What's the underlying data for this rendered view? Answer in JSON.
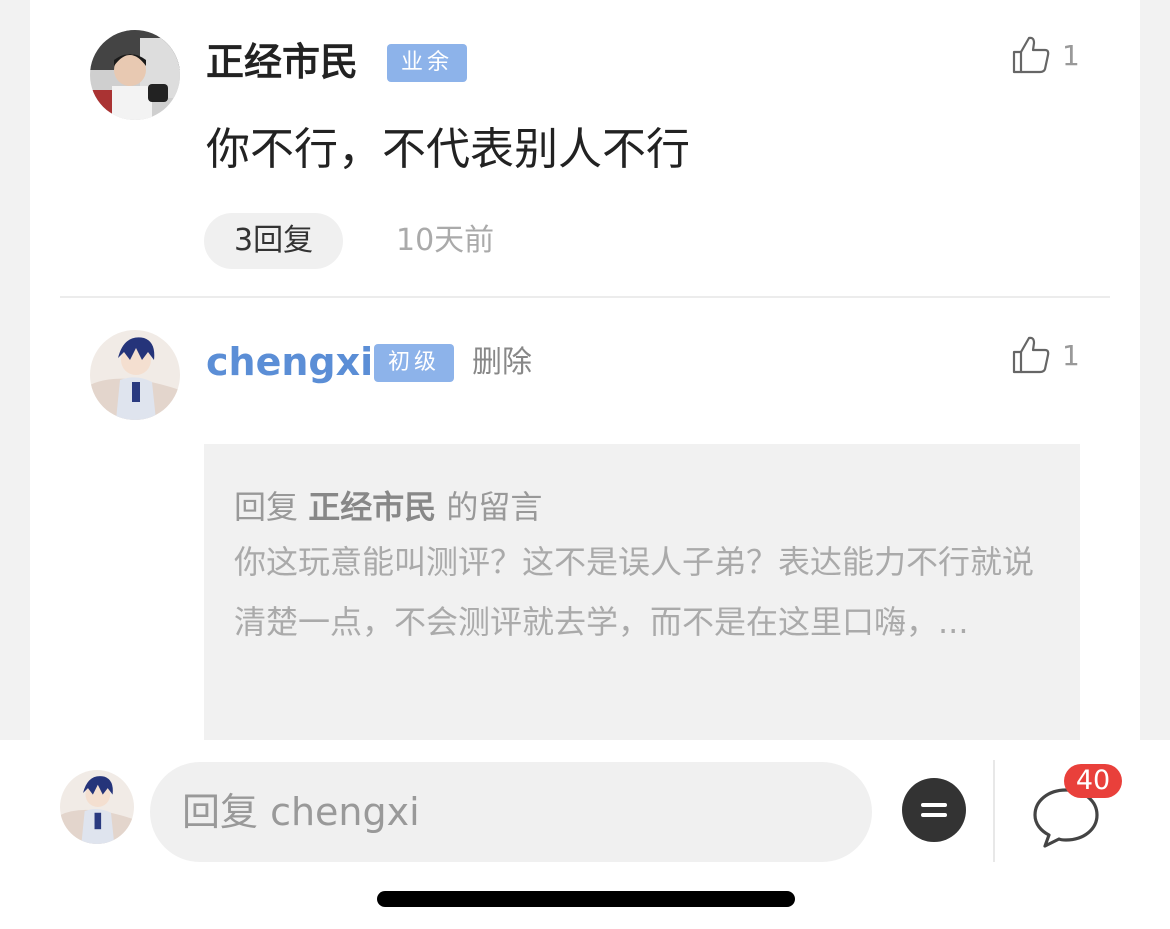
{
  "comment": {
    "username": "正经市民",
    "badge": "业余",
    "like_count": "1",
    "text": "你不行，不代表别人不行",
    "reply_count_label": "3回复",
    "time": "10天前"
  },
  "reply": {
    "username": "chengxi",
    "badge": "初级",
    "delete_label": "删除",
    "like_count": "1",
    "quote_prefix": "回复",
    "quote_target": "正经市民",
    "quote_suffix": "的留言",
    "quote_text": "你这玩意能叫测评？这不是误人子弟？表达能力不行就说清楚一点，不会测评就去学，而不是在这里口嗨，..."
  },
  "bottom_bar": {
    "input_placeholder": "回复 chengxi",
    "message_count": "40"
  },
  "colors": {
    "badge_bg": "#8db3ea",
    "reply_username": "#5b8ed6",
    "notification_red": "#e9403b"
  },
  "icons": [
    "thumbs-up-icon",
    "emoji-icon",
    "message-bubble-icon"
  ]
}
